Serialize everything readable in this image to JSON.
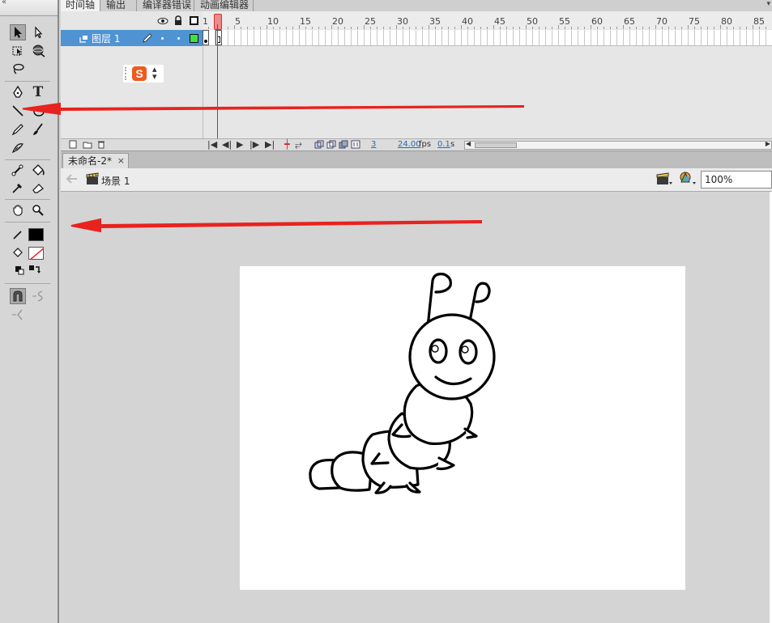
{
  "tools_panel": {
    "grip": "«",
    "tools": [
      {
        "name": "selection-tool-icon"
      },
      {
        "name": "subselection-tool-icon"
      },
      {
        "name": "free-transform-tool-icon"
      },
      {
        "name": "3d-rotation-tool-icon"
      },
      {
        "name": "lasso-tool-icon"
      },
      {
        "name": "pen-tool-icon"
      },
      {
        "name": "text-tool-icon",
        "glyph": "T"
      },
      {
        "name": "line-tool-icon"
      },
      {
        "name": "oval-tool-icon"
      },
      {
        "name": "pencil-tool-icon"
      },
      {
        "name": "brush-tool-icon"
      },
      {
        "name": "deco-tool-icon"
      },
      {
        "name": "bone-tool-icon"
      },
      {
        "name": "paint-bucket-tool-icon"
      },
      {
        "name": "eyedropper-tool-icon"
      },
      {
        "name": "eraser-tool-icon"
      },
      {
        "name": "hand-tool-icon"
      },
      {
        "name": "zoom-tool-icon"
      }
    ],
    "stroke_color": "#000000",
    "fill_color": "none"
  },
  "timeline": {
    "tabs": [
      "时间轴",
      "输出",
      "编译器错误",
      "动画编辑器"
    ],
    "active_tab": "时间轴",
    "ruler_labels": [
      "1",
      "5",
      "10",
      "15",
      "20",
      "25",
      "30",
      "35",
      "40",
      "45",
      "50",
      "55",
      "60",
      "65",
      "70",
      "75",
      "80",
      "85"
    ],
    "layer": {
      "name": "图层 1"
    },
    "current_frame": "3",
    "fps_value": "24.00",
    "fps_unit": "fps",
    "time_value": "0.1",
    "time_unit": "s"
  },
  "ime_badge": "S",
  "document": {
    "tab_title": "未命名-2*",
    "close_glyph": "×",
    "scene": "场景 1",
    "zoom": "100%"
  },
  "colors": {
    "layer_highlight": "#4f93d2",
    "playhead": "#e0202a",
    "annotation_arrow": "#e8231f",
    "ime_badge": "#f05a1e"
  }
}
